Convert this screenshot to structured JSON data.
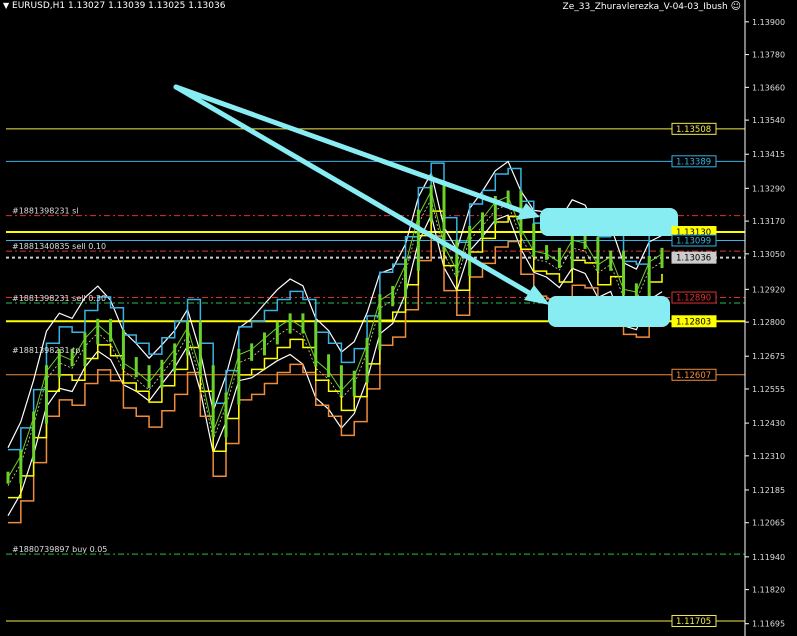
{
  "header": {
    "symbol_line": "EURUSD,H1  1.13027 1.13039 1.13025 1.13036",
    "expert_name": "Ze_33_Zhuravlerezka_V-04-03_Ibush",
    "expert_icon": "smiley-icon"
  },
  "colors": {
    "background": "#000000",
    "candles": "#6dd12a",
    "bands": "#ffffff",
    "arrows": "#88ecf3",
    "highlight": "#88ecf3"
  },
  "chart_data": {
    "type": "line",
    "title": "",
    "series_name": "EURUSD,H1",
    "ylim": [
      1.1165,
      1.1398
    ],
    "y_ticks": [
      "1.13900",
      "1.13780",
      "1.13660",
      "1.13540",
      "1.13415",
      "1.13290",
      "1.13170",
      "1.13050",
      "1.12920",
      "1.12800",
      "1.12675",
      "1.12555",
      "1.12430",
      "1.12310",
      "1.12185",
      "1.12065",
      "1.11940",
      "1.11820",
      "1.11695"
    ],
    "price_close": [
      1.1223,
      1.1231,
      1.1245,
      1.1262,
      1.1268,
      1.1266,
      1.1274,
      1.1279,
      1.1275,
      1.1265,
      1.1262,
      1.1258,
      1.1264,
      1.127,
      1.1278,
      1.1262,
      1.124,
      1.1252,
      1.1268,
      1.127,
      1.1274,
      1.1278,
      1.1281,
      1.1278,
      1.1266,
      1.1262,
      1.1255,
      1.126,
      1.1272,
      1.1288,
      1.1291,
      1.1301,
      1.1319,
      1.1328,
      1.1308,
      1.1299,
      1.1313,
      1.1318,
      1.1324,
      1.1326,
      1.1314,
      1.1306,
      1.1305,
      1.1302,
      1.131,
      1.1309,
      1.1301,
      1.1304,
      1.1292,
      1.1291,
      1.1302,
      1.1305
    ],
    "level_lines": [
      {
        "price": "1.13508",
        "color": "#f2e94e",
        "label_style": "yellow-box"
      },
      {
        "price": "1.13389",
        "color": "#39b3e6",
        "label_style": "blue-box"
      },
      {
        "price": "1.13130",
        "color": "#ffff00",
        "label_style": "yellow-fill"
      },
      {
        "price": "1.13099",
        "color": "#39b3e6",
        "label_style": "blue-box"
      },
      {
        "price": "1.13036",
        "color": "#cccccc",
        "label_style": "white-fill"
      },
      {
        "price": "1.12890",
        "color": "#e03030",
        "label_style": "red-box"
      },
      {
        "price": "1.12803",
        "color": "#ffff00",
        "label_style": "yellow-fill"
      },
      {
        "price": "1.12607",
        "color": "#f08c3c",
        "label_style": "orange-box"
      },
      {
        "price": "1.11705",
        "color": "#f2e94e",
        "label_style": "yellow-box"
      }
    ],
    "order_labels": [
      {
        "text": "#1881398231 sl",
        "price": 1.1319
      },
      {
        "text": "#1881340835 sell 0.10",
        "price": 1.1306
      },
      {
        "text": "#1881398231 sell 0.30",
        "price": 1.1287
      },
      {
        "text": "#1881398231 tp",
        "price": 1.1268
      },
      {
        "text": "#1880739897 buy 0.05",
        "price": 1.1195
      }
    ]
  }
}
